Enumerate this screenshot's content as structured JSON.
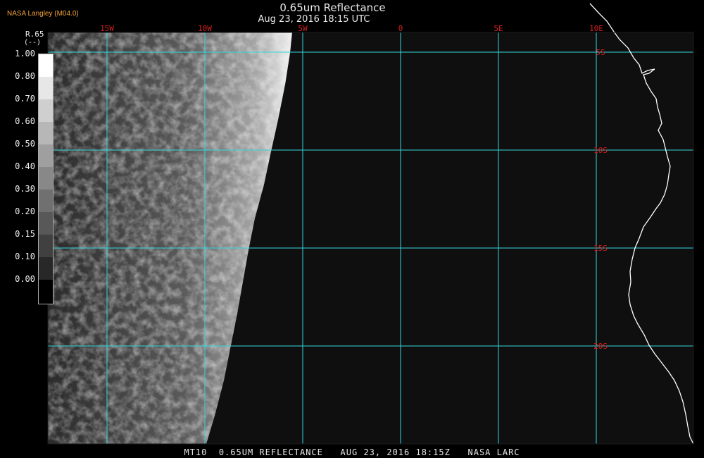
{
  "header": {
    "credit": "NASA Langley (M04.0)",
    "title": "0.65um Reflectance",
    "subtitle": "Aug 23, 2016 18:15 UTC"
  },
  "legend": {
    "name": "R.65",
    "units": "(--)",
    "ticks": [
      "1.00",
      "0.80",
      "0.70",
      "0.60",
      "0.50",
      "0.40",
      "0.30",
      "0.20",
      "0.15",
      "0.10",
      "0.00"
    ]
  },
  "grid": {
    "color": "#35d6dc",
    "lon_labels": [
      "15W",
      "10W",
      "5W",
      "0",
      "5E",
      "10E"
    ],
    "lat_labels": [
      "5S",
      "10S",
      "15S",
      "20S"
    ],
    "label_color": "#d02020"
  },
  "footer": {
    "text": "MT10  0.65UM REFLECTANCE   AUG 23, 2016 18:15Z   NASA LARC"
  },
  "coastline_color": "#ffffff",
  "background_color": "#0f0f0f"
}
